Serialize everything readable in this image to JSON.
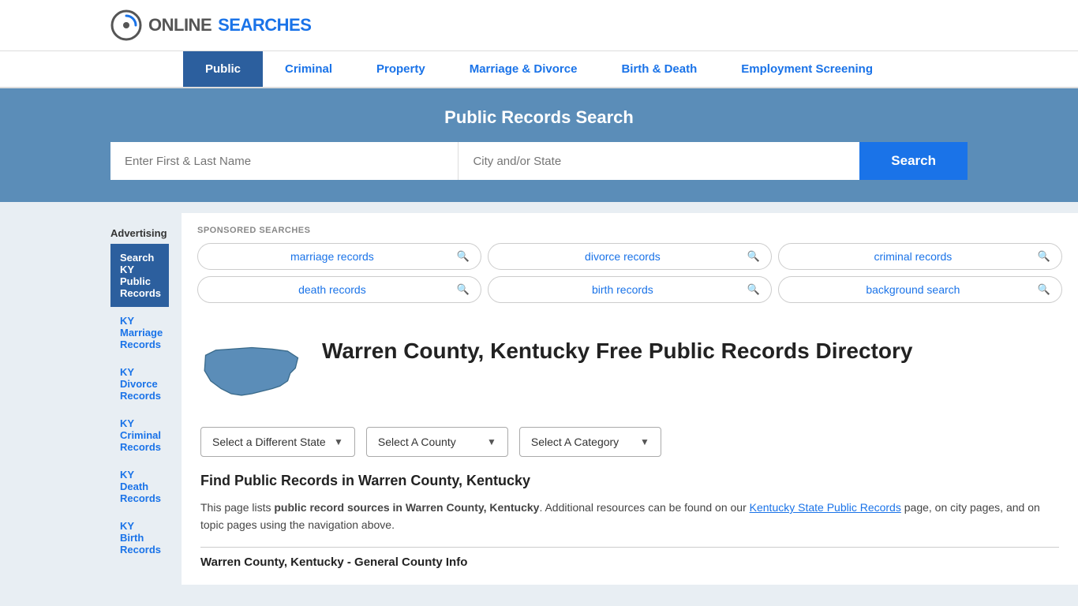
{
  "header": {
    "logo_text_online": "ONLINE",
    "logo_text_searches": "SEARCHES"
  },
  "nav": {
    "items": [
      {
        "id": "public",
        "label": "Public",
        "active": true
      },
      {
        "id": "criminal",
        "label": "Criminal",
        "active": false
      },
      {
        "id": "property",
        "label": "Property",
        "active": false
      },
      {
        "id": "marriage-divorce",
        "label": "Marriage & Divorce",
        "active": false
      },
      {
        "id": "birth-death",
        "label": "Birth & Death",
        "active": false
      },
      {
        "id": "employment-screening",
        "label": "Employment Screening",
        "active": false
      }
    ]
  },
  "search_banner": {
    "title": "Public Records Search",
    "name_placeholder": "Enter First & Last Name",
    "city_placeholder": "City and/or State",
    "button_label": "Search"
  },
  "sponsored": {
    "label": "SPONSORED SEARCHES",
    "pills": [
      {
        "text": "marriage records"
      },
      {
        "text": "divorce records"
      },
      {
        "text": "criminal records"
      },
      {
        "text": "death records"
      },
      {
        "text": "birth records"
      },
      {
        "text": "background search"
      }
    ]
  },
  "directory": {
    "title": "Warren County, Kentucky Free Public Records Directory",
    "dropdowns": [
      {
        "id": "state-dropdown",
        "label": "Select a Different State"
      },
      {
        "id": "county-dropdown",
        "label": "Select A County"
      },
      {
        "id": "category-dropdown",
        "label": "Select A Category"
      }
    ],
    "find_title": "Find Public Records in Warren County, Kentucky",
    "find_text_part1": "This page lists ",
    "find_text_bold": "public record sources in Warren County, Kentucky",
    "find_text_part2": ". Additional resources can be found on our ",
    "find_link_text": "Kentucky State Public Records",
    "find_text_part3": " page, on city pages, and on topic pages using the navigation above.",
    "general_info_title": "Warren County, Kentucky - General County Info"
  },
  "sidebar": {
    "advertising_label": "Advertising",
    "ad_items": [
      {
        "label": "Search KY Public Records",
        "active": true
      },
      {
        "label": "KY Marriage Records",
        "active": false
      },
      {
        "label": "KY Divorce Records",
        "active": false
      },
      {
        "label": "KY Criminal Records",
        "active": false
      },
      {
        "label": "KY Death Records",
        "active": false
      },
      {
        "label": "KY Birth Records",
        "active": false
      }
    ]
  },
  "colors": {
    "nav_active_bg": "#2c5f9e",
    "search_banner_bg": "#5b8db8",
    "search_btn_bg": "#1a73e8",
    "link_color": "#1a73e8",
    "sidebar_active_bg": "#2c5f9e"
  }
}
